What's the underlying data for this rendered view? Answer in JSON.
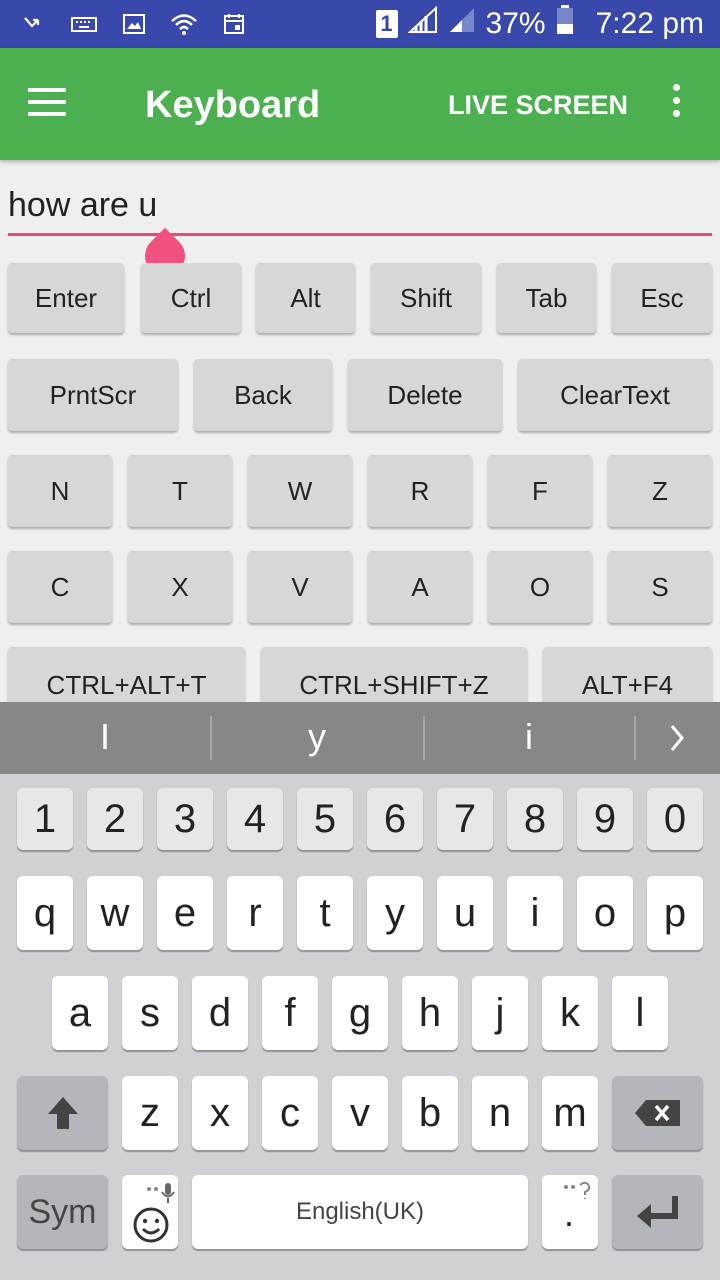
{
  "status_bar": {
    "battery_percent": "37%",
    "time": "7:22 pm",
    "sim_label": "1"
  },
  "app_bar": {
    "title": "Keyboard",
    "live_screen_label": "LIVE SCREEN"
  },
  "text_field": {
    "value": "how are u"
  },
  "rows": {
    "row1": [
      "Enter",
      "Ctrl",
      "Alt",
      "Shift",
      "Tab",
      "Esc"
    ],
    "row2": [
      "PrntScr",
      "Back",
      "Delete",
      "ClearText"
    ],
    "row3": [
      "N",
      "T",
      "W",
      "R",
      "F",
      "Z"
    ],
    "row4": [
      "C",
      "X",
      "V",
      "A",
      "O",
      "S"
    ],
    "row5": [
      "CTRL+ALT+T",
      "CTRL+SHIFT+Z",
      "ALT+F4"
    ]
  },
  "keyboard": {
    "suggestions": [
      "I",
      "y",
      "i"
    ],
    "numbers": [
      "1",
      "2",
      "3",
      "4",
      "5",
      "6",
      "7",
      "8",
      "9",
      "0"
    ],
    "row_q": [
      "q",
      "w",
      "e",
      "r",
      "t",
      "y",
      "u",
      "i",
      "o",
      "p"
    ],
    "row_a": [
      "a",
      "s",
      "d",
      "f",
      "g",
      "h",
      "j",
      "k",
      "l"
    ],
    "row_z": [
      "z",
      "x",
      "c",
      "v",
      "b",
      "n",
      "m"
    ],
    "sym_label": "Sym",
    "space_label": "English(UK)",
    "period_label": "."
  },
  "colors": {
    "status_bar": "#3949ab",
    "app_bar": "#4caf50",
    "accent": "#e5487a"
  }
}
